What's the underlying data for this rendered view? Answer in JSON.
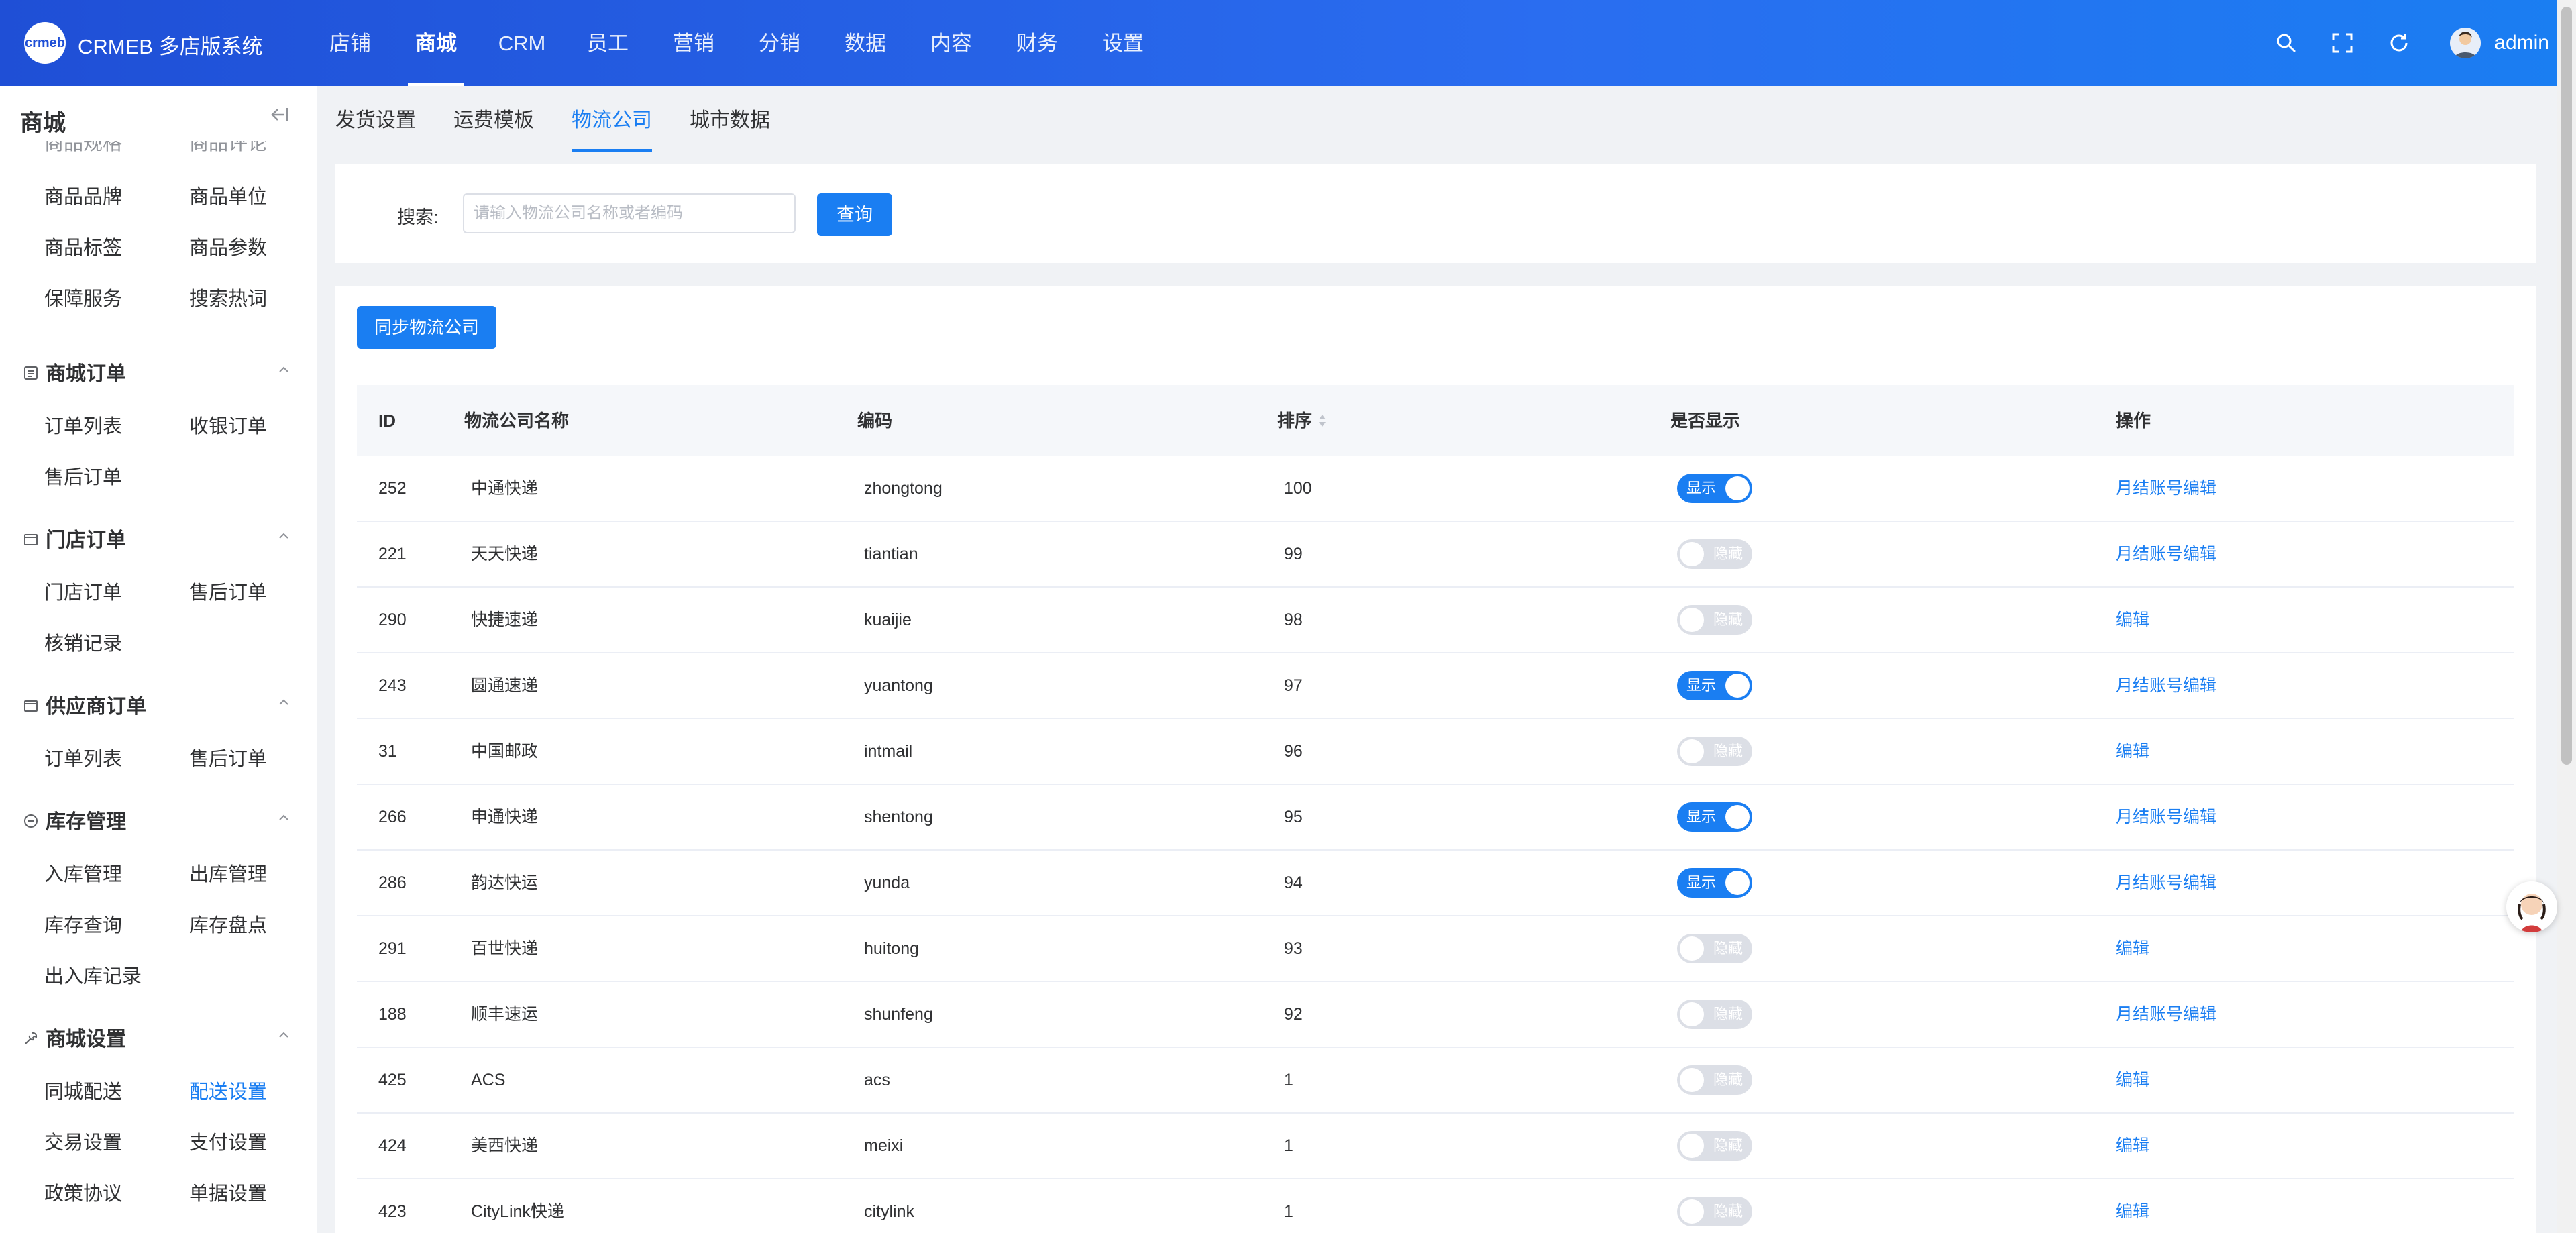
{
  "header": {
    "brand": "CRMEB 多店版系统",
    "logo_text": "crmeb",
    "nav": [
      "店铺",
      "商城",
      "CRM",
      "员工",
      "营销",
      "分销",
      "数据",
      "内容",
      "财务",
      "设置"
    ],
    "active_nav": "商城",
    "user": "admin",
    "icons": [
      "search-icon",
      "fullscreen-icon",
      "refresh-icon",
      "user-avatar"
    ]
  },
  "sidebar": {
    "title": "商城",
    "partial_top": [
      "商品规格",
      "商品评论"
    ],
    "items_top": [
      [
        "商品品牌",
        "商品单位"
      ],
      [
        "商品标签",
        "商品参数"
      ],
      [
        "保障服务",
        "搜索热词"
      ]
    ],
    "groups": [
      {
        "title": "商城订单",
        "rows": [
          [
            "订单列表",
            "收银订单"
          ],
          [
            "售后订单",
            ""
          ]
        ]
      },
      {
        "title": "门店订单",
        "rows": [
          [
            "门店订单",
            "售后订单"
          ],
          [
            "核销记录",
            ""
          ]
        ]
      },
      {
        "title": "供应商订单",
        "rows": [
          [
            "订单列表",
            "售后订单"
          ]
        ]
      },
      {
        "title": "库存管理",
        "rows": [
          [
            "入库管理",
            "出库管理"
          ],
          [
            "库存查询",
            "库存盘点"
          ],
          [
            "出入库记录",
            ""
          ]
        ]
      },
      {
        "title": "商城设置",
        "rows": [
          [
            "同城配送",
            "配送设置"
          ],
          [
            "交易设置",
            "支付设置"
          ],
          [
            "政策协议",
            "单据设置"
          ]
        ]
      }
    ],
    "active_item": "配送设置"
  },
  "tabs": [
    "发货设置",
    "运费模板",
    "物流公司",
    "城市数据"
  ],
  "active_tab": "物流公司",
  "search": {
    "label": "搜索:",
    "placeholder": "请输入物流公司名称或者编码",
    "value": "",
    "button": "查询"
  },
  "sync_button": "同步物流公司",
  "table": {
    "columns": [
      "ID",
      "物流公司名称",
      "编码",
      "排序",
      "是否显示",
      "操作"
    ],
    "toggle_on_label": "显示",
    "toggle_off_label": "隐藏",
    "rows": [
      {
        "id": "252",
        "name": "中通快递",
        "code": "zhongtong",
        "sort": "100",
        "show": true,
        "action": "月结账号编辑"
      },
      {
        "id": "221",
        "name": "天天快递",
        "code": "tiantian",
        "sort": "99",
        "show": false,
        "action": "月结账号编辑"
      },
      {
        "id": "290",
        "name": "快捷速递",
        "code": "kuaijie",
        "sort": "98",
        "show": false,
        "action": "编辑"
      },
      {
        "id": "243",
        "name": "圆通速递",
        "code": "yuantong",
        "sort": "97",
        "show": true,
        "action": "月结账号编辑"
      },
      {
        "id": "31",
        "name": "中国邮政",
        "code": "intmail",
        "sort": "96",
        "show": false,
        "action": "编辑"
      },
      {
        "id": "266",
        "name": "申通快递",
        "code": "shentong",
        "sort": "95",
        "show": true,
        "action": "月结账号编辑"
      },
      {
        "id": "286",
        "name": "韵达快运",
        "code": "yunda",
        "sort": "94",
        "show": true,
        "action": "月结账号编辑"
      },
      {
        "id": "291",
        "name": "百世快递",
        "code": "huitong",
        "sort": "93",
        "show": false,
        "action": "编辑"
      },
      {
        "id": "188",
        "name": "顺丰速运",
        "code": "shunfeng",
        "sort": "92",
        "show": false,
        "action": "月结账号编辑"
      },
      {
        "id": "425",
        "name": "ACS",
        "code": "acs",
        "sort": "1",
        "show": false,
        "action": "编辑"
      },
      {
        "id": "424",
        "name": "美西快递",
        "code": "meixi",
        "sort": "1",
        "show": false,
        "action": "编辑"
      },
      {
        "id": "423",
        "name": "CityLink快递",
        "code": "citylink",
        "sort": "1",
        "show": false,
        "action": "编辑"
      }
    ]
  },
  "colors": {
    "primary": "#1a7ef2",
    "header_start": "#1f4fd6",
    "header_end": "#1a7ef2",
    "toggle_off": "#dcdfe6"
  }
}
